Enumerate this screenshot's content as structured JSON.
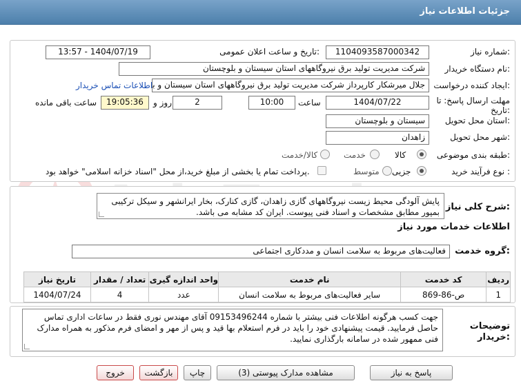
{
  "header": {
    "title": "جزئیات اطلاعات نیاز"
  },
  "fields": {
    "need_number_label": "شماره نیاز:",
    "need_number": "1104093587000342",
    "announce_label": "تاریخ و ساعت اعلان عمومی:",
    "announce_value": "1404/07/19 - 13:57",
    "buyer_org_label": "نام دستگاه خریدار:",
    "buyer_org": "شرکت مدیریت تولید برق نیروگاههای استان سیستان و بلوچستان",
    "creator_label": "ایجاد کننده درخواست:",
    "creator": "جلال میرشکار کارپرداز شرکت مدیریت تولید برق نیروگاههای استان سیستان و بلوچستان",
    "contact_link": "اطلاعات تماس خریدار",
    "deadline_label_1": "مهلت ارسال پاسخ: تا",
    "deadline_label_2": "تاریخ:",
    "deadline_date": "1404/07/22",
    "hour_label": "ساعت",
    "deadline_hour": "10:00",
    "days_value": "2",
    "days_label": "روز و",
    "remaining_time": "19:05:36",
    "remaining_label": "ساعت باقی مانده",
    "province_label": "استان محل تحویل:",
    "province": "سیستان و بلوچستان",
    "city_label": "شهر محل تحویل:",
    "city": "زاهدان",
    "category_label": "طبقه بندی موضوعی:",
    "category_options": [
      "کالا",
      "خدمت",
      "کالا/خدمت"
    ],
    "process_label": "نوع فرآیند خرید :",
    "process_options": [
      "جزیی",
      "متوسط"
    ],
    "payment_note": "پرداخت تمام یا بخشی از مبلغ خرید،از محل \"اسناد خزانه اسلامی\" خواهد بود."
  },
  "description": {
    "label": "شرح کلی نیاز:",
    "text": "پایش آلودگی محیط زیست نیروگاههای گازی زاهدان، گازی کنارک، بخار ایرانشهر و سیکل ترکیبی بمپور مطابق مشخصات و اسناد فنی پیوست. ایران کد مشابه می باشد."
  },
  "services": {
    "section_title": "اطلاعات خدمات مورد نیاز",
    "group_label": "گروه خدمت:",
    "group_value": "فعالیت‌های مربوط به سلامت انسان و مددکاری اجتماعی",
    "columns": [
      "ردیف",
      "کد خدمت",
      "نام خدمت",
      "واحد اندازه گیری",
      "تعداد / مقدار",
      "تاریخ نیاز"
    ],
    "rows": [
      [
        "1",
        "ص-86-869",
        "سایر فعالیت‌های مربوط به سلامت انسان",
        "عدد",
        "4",
        "1404/07/24"
      ]
    ]
  },
  "buyer_notes": {
    "label_1": "توضیحات",
    "label_2": "خریدار:",
    "text": "جهت کسب هرگونه اطلاعات فنی بیشتر با شماره 09153496244 آقای مهندس نوری فقط در ساعات اداری تماس حاصل فرمایید. قیمت پیشنهادی خود را باید در فرم استعلام بها قید و پس از مهر و امضای فرم مذکور به همراه مدارک فنی ممهور شده در سامانه بارگذاری نمایید."
  },
  "buttons": {
    "reply": "پاسخ به نیاز",
    "attachments": "مشاهده مدارک پیوستی (3)",
    "print": "چاپ",
    "back": "بازگشت",
    "exit": "خروج"
  },
  "watermark": {
    "text": "AriaTender.net"
  },
  "colors": {
    "header": "#4c7fab",
    "link": "#1b4fb5",
    "time_bg": "#fff9cc",
    "exit_border": "#c94848"
  }
}
